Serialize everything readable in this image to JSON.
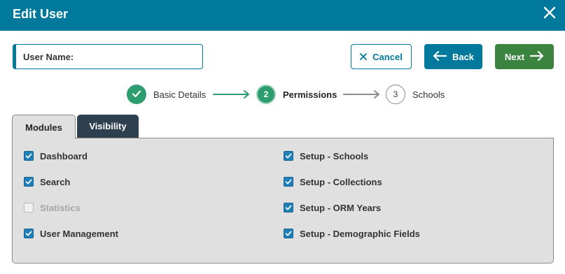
{
  "dialog": {
    "title": "Edit User"
  },
  "user_name": {
    "label": "User Name:"
  },
  "buttons": {
    "cancel": "Cancel",
    "back": "Back",
    "next": "Next"
  },
  "steps": [
    {
      "label": "Basic Details",
      "marker": "✓",
      "state": "complete"
    },
    {
      "label": "Permissions",
      "marker": "2",
      "state": "current"
    },
    {
      "label": "Schools",
      "marker": "3",
      "state": "upcoming"
    }
  ],
  "tabs": [
    {
      "label": "Modules",
      "active": true
    },
    {
      "label": "Visibility",
      "active": false
    }
  ],
  "permissions": {
    "left": [
      {
        "label": "Dashboard",
        "checked": true,
        "enabled": true
      },
      {
        "label": "Search",
        "checked": true,
        "enabled": true
      },
      {
        "label": "Statistics",
        "checked": false,
        "enabled": false
      },
      {
        "label": "User Management",
        "checked": true,
        "enabled": true
      }
    ],
    "right": [
      {
        "label": "Setup - Schools",
        "checked": true,
        "enabled": true
      },
      {
        "label": "Setup - Collections",
        "checked": true,
        "enabled": true
      },
      {
        "label": "Setup - ORM Years",
        "checked": true,
        "enabled": true
      },
      {
        "label": "Setup - Demographic Fields",
        "checked": true,
        "enabled": true
      }
    ]
  },
  "colors": {
    "header": "#00799c",
    "next_button": "#3b8440",
    "step_complete": "#2d9c6e",
    "checkbox": "#1f7fb8",
    "tab_inactive": "#2e3f50",
    "panel": "#e0e0e0"
  },
  "icons": {
    "close": "close-icon",
    "cancel": "x-icon",
    "back": "arrow-left-icon",
    "next": "arrow-right-icon",
    "step_complete": "check-icon",
    "checkbox": "checkmark-icon"
  }
}
